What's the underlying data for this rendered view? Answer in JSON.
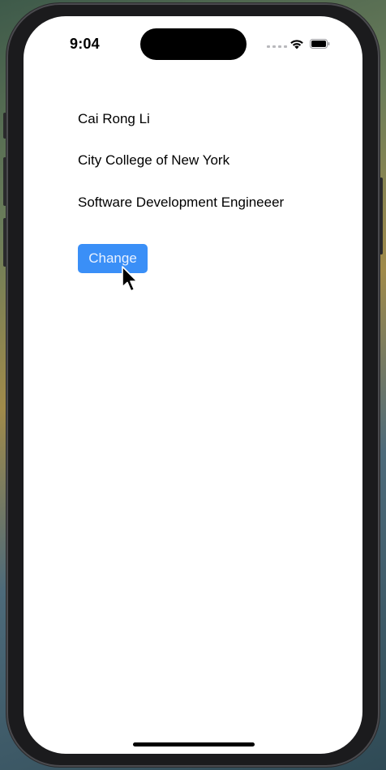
{
  "status_bar": {
    "time": "9:04",
    "signal_icon": "cellular-signal-icon",
    "wifi_icon": "wifi-icon",
    "battery_icon": "battery-icon"
  },
  "profile": {
    "name": "Cai Rong Li",
    "school": "City College of New York",
    "title": "Software Development Engineeer"
  },
  "actions": {
    "change_label": "Change"
  },
  "colors": {
    "button_bg": "#3a8ff7",
    "button_text": "#e8f1ff",
    "screen_bg": "#ffffff",
    "text": "#000000"
  }
}
